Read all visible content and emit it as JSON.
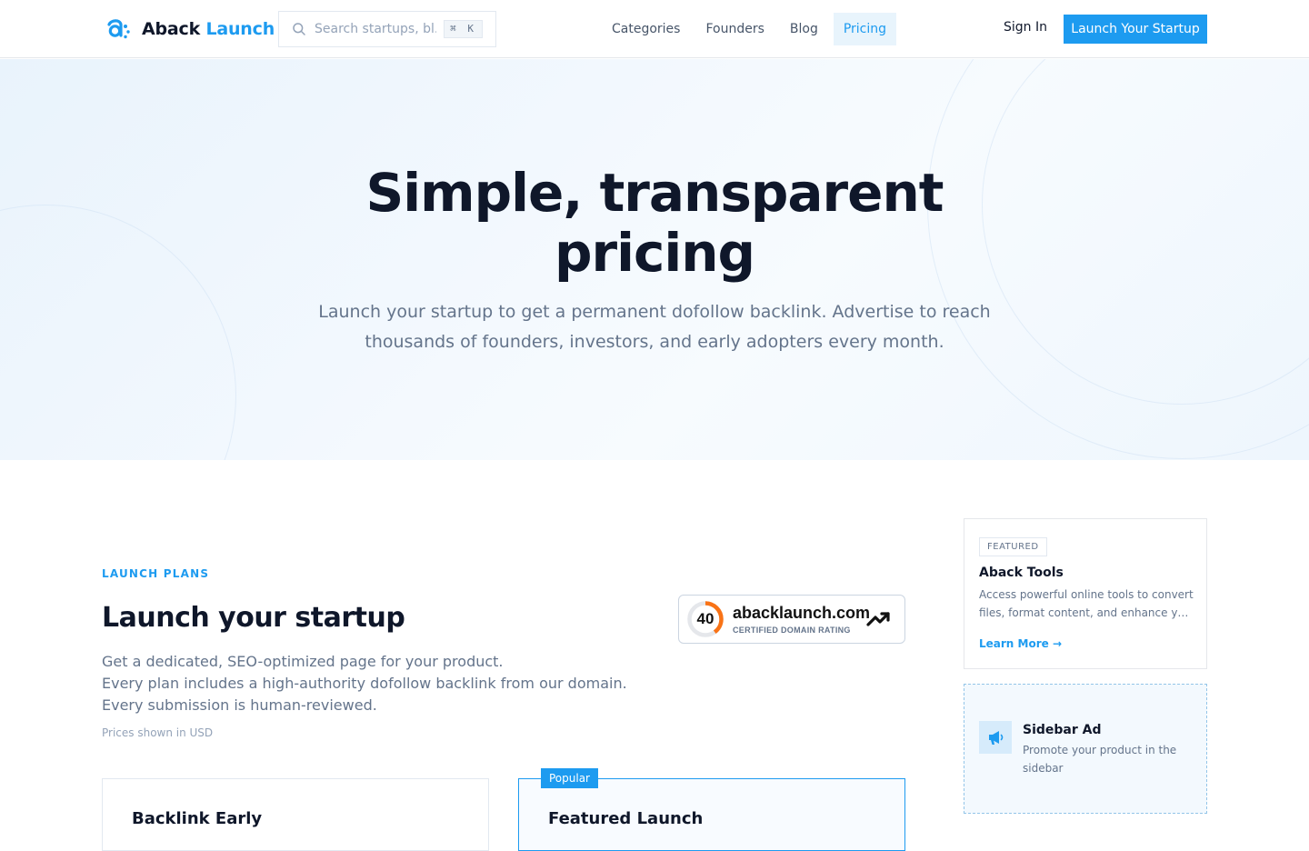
{
  "header": {
    "brand_prefix": "Aback",
    "brand_suffix": "Launch",
    "search_placeholder": "Search startups, bl...",
    "search_shortcut": "⌘ K",
    "nav": [
      {
        "label": "Categories",
        "active": false
      },
      {
        "label": "Founders",
        "active": false
      },
      {
        "label": "Blog",
        "active": false
      },
      {
        "label": "Pricing",
        "active": true
      }
    ],
    "sign_in": "Sign In",
    "cta": "Launch Your Startup"
  },
  "hero": {
    "title_line1": "Simple, transparent",
    "title_line2": "pricing",
    "subtitle_line1": "Launch your startup to get a permanent dofollow backlink. Advertise to reach",
    "subtitle_line2": "thousands of founders, investors, and early adopters every month."
  },
  "launch": {
    "eyebrow": "LAUNCH PLANS",
    "title": "Launch your startup",
    "desc_lines": [
      "Get a dedicated, SEO-optimized page for your product.",
      "Every plan includes a high-authority dofollow backlink from our domain.",
      "Every submission is human-reviewed."
    ],
    "price_note": "Prices shown in USD",
    "domain_rating": {
      "score": "40",
      "score_fraction": 0.4,
      "domain": "abacklaunch.com",
      "label": "CERTIFIED DOMAIN RATING"
    },
    "plans": [
      {
        "name": "Backlink Early"
      },
      {
        "name": "Featured Launch",
        "badge": "Popular"
      }
    ]
  },
  "sidebar": {
    "featured": {
      "tag": "FEATURED",
      "title": "Aback Tools",
      "desc_line1": "Access powerful online tools to convert",
      "desc_line2": "files, format content, and enhance your...",
      "link": "Learn More →"
    },
    "ad": {
      "title": "Sidebar Ad",
      "desc": "Promote your product in the sidebar"
    }
  },
  "colors": {
    "accent": "#1d9bf0",
    "heading": "#0f172a",
    "muted": "#64748b",
    "rating_ring": "#f97316"
  },
  "icons": [
    "logo-icon",
    "search-icon",
    "trending-up-icon",
    "megaphone-icon"
  ]
}
